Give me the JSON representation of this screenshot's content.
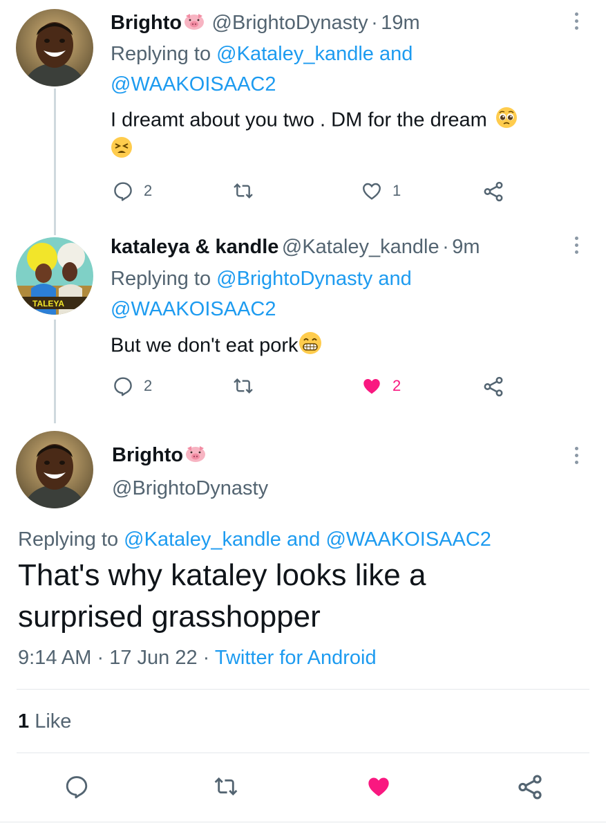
{
  "tweet1": {
    "display_name": "Brighto",
    "name_emoji": "pig-face-emoji",
    "handle": "@BrightoDynasty",
    "separator": "·",
    "time": "19m",
    "replying_prefix": "Replying to",
    "reply_to_1": "@Kataley_kandle",
    "and_word": "and",
    "reply_to_2": "@WAAKOISAAC2",
    "text": "I dreamt about you two . DM for the dream",
    "emojis": [
      "pleading-face-emoji",
      "tired-face-emoji"
    ],
    "reply_count": "2",
    "retweet_count": "",
    "like_count": "1",
    "liked": false
  },
  "tweet2": {
    "display_name": "kataleya & kandle",
    "handle": "@Kataley_kandle",
    "separator": "·",
    "time": "9m",
    "replying_prefix": "Replying to",
    "reply_to_1": "@BrightoDynasty",
    "and_word": "and",
    "reply_to_2": "@WAAKOISAAC2",
    "text": "But we don't eat pork",
    "emojis": [
      "grinning-face-emoji"
    ],
    "reply_count": "2",
    "retweet_count": "",
    "like_count": "2",
    "liked": true,
    "avatar_banner_text": "TALEYA"
  },
  "main_tweet": {
    "display_name": "Brighto",
    "name_emoji": "pig-face-emoji",
    "handle": "@BrightoDynasty",
    "replying_prefix": "Replying to",
    "reply_to_1": "@Kataley_kandle",
    "and_word": "and",
    "reply_to_2": "@WAAKOISAAC2",
    "text_line1": "That's why kataley looks like a",
    "text_line2": "surprised grasshopper",
    "time": "9:14 AM",
    "separator": "·",
    "date": "17 Jun 22",
    "source": "Twitter for Android",
    "likes_count": "1",
    "likes_label": "Like",
    "liked": true
  },
  "colors": {
    "accent_blue": "#1d9bf0",
    "like_pink": "#f91880",
    "muted_gray": "#536471"
  }
}
